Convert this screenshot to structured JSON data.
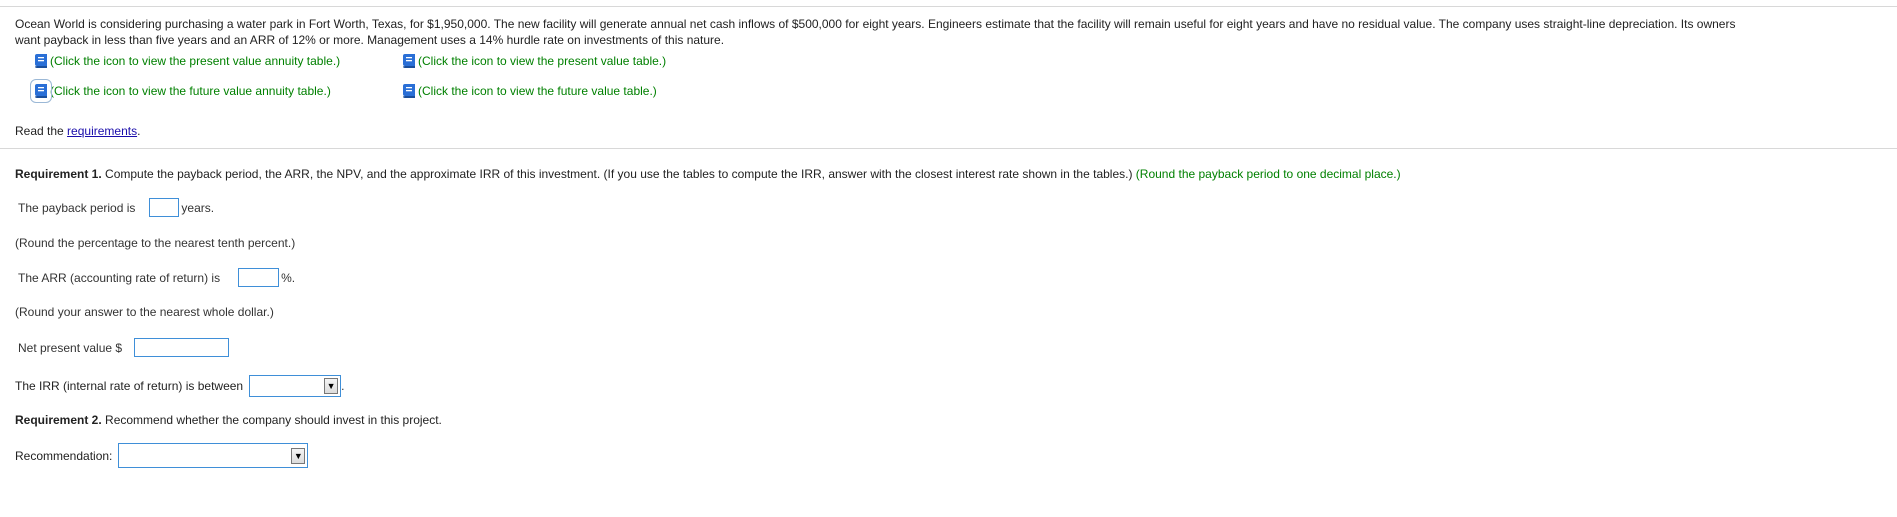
{
  "problem": {
    "intro_line1": "Ocean World is considering purchasing a water park in Fort Worth, Texas, for $1,950,000. The new facility will generate annual net cash inflows of $500,000 for eight years. Engineers estimate that the facility will remain useful for eight years and have no residual value. The company uses straight-line depreciation. Its owners",
    "intro_line2": "want payback in less than five years and an ARR of 12% or more. Management uses a 14% hurdle rate on investments of this nature."
  },
  "table_links": [
    {
      "label": "(Click the icon to view the present value annuity table.)",
      "icon": "book-icon"
    },
    {
      "label": "(Click the icon to view the present value table.)",
      "icon": "book-icon"
    },
    {
      "label": "(Click the icon to view the future value annuity table.)",
      "icon": "book-icon"
    },
    {
      "label": "(Click the icon to view the future value table.)",
      "icon": "book-icon"
    }
  ],
  "read": {
    "prefix": "Read the ",
    "link": "requirements",
    "suffix": "."
  },
  "requirement1": {
    "title": "Requirement 1.",
    "text": " Compute the payback period, the ARR, the NPV, and the approximate IRR of this investment. (If you use the tables to compute the IRR, answer with the closest interest rate shown in the tables.) ",
    "hint": "(Round the payback period to one decimal place.)"
  },
  "payback": {
    "label": "The payback period is",
    "value": "",
    "unit": "years."
  },
  "arr_hint": "(Round the percentage to the nearest tenth percent.)",
  "arr": {
    "label": "The ARR (accounting rate of return) is",
    "value": "",
    "unit": "%."
  },
  "npv_hint": "(Round your answer to the nearest whole dollar.)",
  "npv": {
    "label": "Net present value $",
    "value": ""
  },
  "irr": {
    "label": "The IRR (internal rate of return) is between",
    "selected": "",
    "suffix": "."
  },
  "requirement2": {
    "title": "Requirement 2.",
    "text": " Recommend whether the company should invest in this project."
  },
  "recommendation": {
    "label": "Recommendation:",
    "selected": ""
  },
  "colors": {
    "link_green": "#008000",
    "field_border": "#3f8fd8",
    "hyperlink": "#1a0dab",
    "icon_blue": "#2a6fd6"
  }
}
